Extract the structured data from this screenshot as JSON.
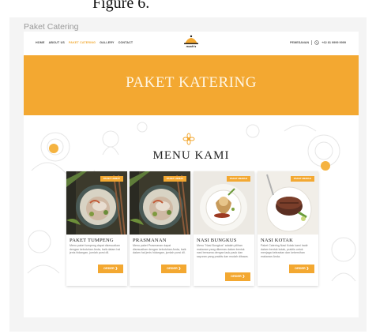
{
  "caption": "Figure 6.",
  "frame_title": "Paket Catering",
  "nav": {
    "links": [
      "HOME",
      "ABOUT US",
      "PAKET CATERING",
      "GALLERY",
      "CONTACT"
    ],
    "active_index": 2,
    "logo_text": "noah's",
    "order_label": "PEMESANAN",
    "phone": "+62 81 9999 9999"
  },
  "banner": {
    "title": "PAKET KATERING",
    "color": "#f3a831"
  },
  "menu": {
    "title": "MENU KAMI",
    "accent": "#f3a831",
    "items": [
      {
        "badge": "PAKET HEMAT",
        "title": "PAKET TUMPENG",
        "desc": "Menu paket tumpeng dapat disesuaikan dengan kebutuhan Anda, baik dalam hal jenis hidangan, jumlah porsi dll.",
        "button": "ORDER ❯"
      },
      {
        "badge": "PAKET HEMAT",
        "title": "PRASMANAN",
        "desc": "Menu paket Prasmanan dapat disesuaikan dengan kebutuhan Anda, baik dalam hal jenis hidangan, jumlah porsi dll.",
        "button": "ORDER ❯"
      },
      {
        "badge": "PAKET MEWAH",
        "title": "NASI BUNGKUS",
        "desc": "Menu \"Nasi Bungkus\" adalah pilihan makanan yang dikemas dalam bentuk nasi bersama dengan lauk-pauk dan sayuran yang praktis dan mudah dibawa.",
        "button": "ORDER ❯"
      },
      {
        "badge": "PAKET MEWAH",
        "title": "NASI KOTAK",
        "desc": "Paket Catering Nasi Kotak kami hadir dalam bentuk kotak, praktis untuk menjaga kelezatan dan kebersihan makanan Anda.",
        "button": "ORDER ❯"
      }
    ]
  }
}
